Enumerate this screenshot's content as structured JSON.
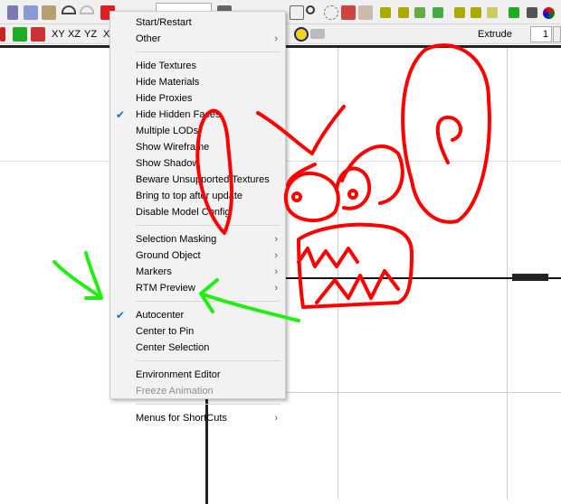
{
  "toolbar2": {
    "views": [
      "XY",
      "XZ",
      "YZ",
      "X"
    ],
    "extrude_label": "Extrude",
    "extrude_value": "1"
  },
  "menu": {
    "items": [
      {
        "label": "Start/Restart"
      },
      {
        "label": "Other",
        "submenu": true
      },
      {
        "sep": true
      },
      {
        "label": "Hide Textures"
      },
      {
        "label": "Hide Materials"
      },
      {
        "label": "Hide Proxies"
      },
      {
        "label": "Hide Hidden Faces",
        "checked": true
      },
      {
        "label": "Multiple LODs"
      },
      {
        "label": "Show Wireframe"
      },
      {
        "label": "Show Shadow"
      },
      {
        "label": "Beware Unsupported Textures"
      },
      {
        "label": "Bring to top after update"
      },
      {
        "label": "Disable Model Config"
      },
      {
        "sep": true
      },
      {
        "label": "Selection Masking",
        "submenu": true
      },
      {
        "label": "Ground Object",
        "submenu": true
      },
      {
        "label": "Markers",
        "submenu": true
      },
      {
        "label": "RTM Preview",
        "submenu": true
      },
      {
        "sep": true
      },
      {
        "label": "Autocenter",
        "checked": true
      },
      {
        "label": "Center to Pin"
      },
      {
        "label": "Center Selection"
      },
      {
        "sep": true
      },
      {
        "label": "Environment Editor"
      },
      {
        "label": "Freeze Animation",
        "disabled": true
      },
      {
        "sep": true
      },
      {
        "label": "Menus for ShortCuts",
        "submenu": true
      }
    ]
  },
  "colors": {
    "check": "#1a73c9",
    "doodle_red": "#ff0000",
    "doodle_green": "#22ee11"
  }
}
